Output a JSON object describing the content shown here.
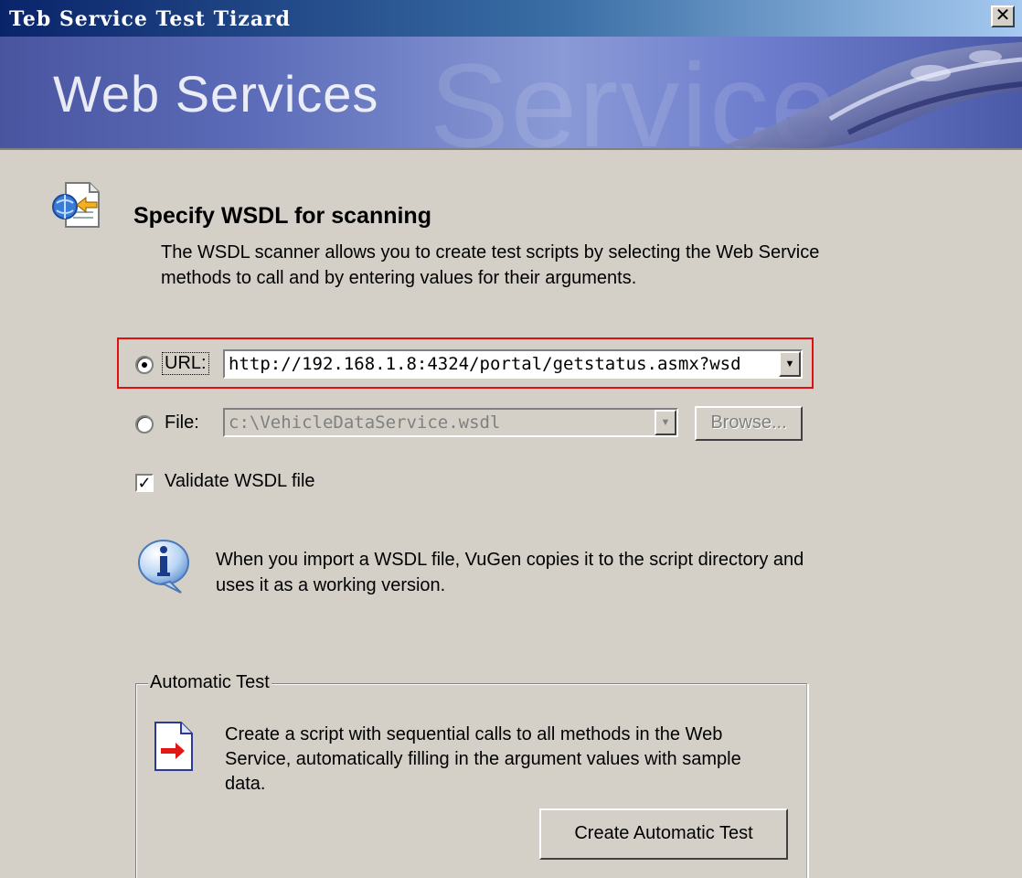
{
  "window": {
    "title": "Teb Service Test Tizard",
    "close_glyph": "✕"
  },
  "banner": {
    "title": "Web Services",
    "ghost_text": "Service"
  },
  "header": {
    "heading": "Specify WSDL for scanning",
    "description": "The WSDL scanner allows you to create test scripts by selecting the Web Service methods to call and by entering values for their arguments."
  },
  "source": {
    "url_label": "URL:",
    "url_value": "http://192.168.1.8:4324/portal/getstatus.asmx?wsd",
    "url_selected": true,
    "file_label": "File:",
    "file_value": "c:\\VehicleDataService.wsdl",
    "browse_label": "Browse..."
  },
  "validate": {
    "label": "Validate WSDL file",
    "checked": true
  },
  "info": {
    "text": "When you import a WSDL file, VuGen copies it to the script directory and uses it as a working version."
  },
  "automatic_test": {
    "group_title": "Automatic Test",
    "description": "Create a script with sequential calls to all methods in the Web Service, automatically filling in the argument values with sample data.",
    "button_label": "Create Automatic Test"
  },
  "icons": {
    "header": "wsdl-import-icon",
    "info": "info-icon",
    "auto": "document-arrow-icon",
    "dropdown": "chevron-down-icon"
  },
  "colors": {
    "highlight": "#e01010",
    "titlebar": "#0a246a",
    "dialog_bg": "#d4d0c8"
  }
}
